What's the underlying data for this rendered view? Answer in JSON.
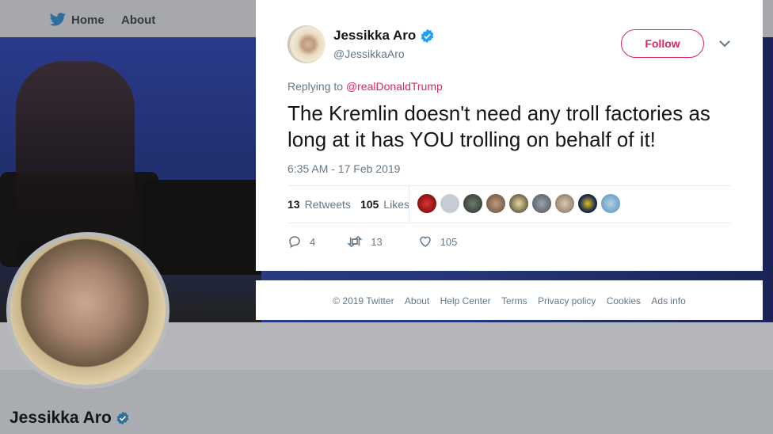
{
  "nav": {
    "home_label": "Home",
    "about_label": "About"
  },
  "profile": {
    "name": "Jessikka Aro"
  },
  "tweet": {
    "author_name": "Jessikka Aro",
    "author_handle": "@JessikkaAro",
    "follow_label": "Follow",
    "replying_prefix": "Replying to",
    "replying_to": "@realDonaldTrump",
    "text": "The Kremlin doesn't need any troll factories as long at it has YOU trolling on behalf of it!",
    "timestamp": "6:35 AM - 17 Feb 2019",
    "retweets_count": "13",
    "retweets_label": "Retweets",
    "likes_count": "105",
    "likes_label": "Likes",
    "reply_count": "4",
    "retweet_count": "13",
    "like_count": "105"
  },
  "footer": {
    "links": [
      "© 2019 Twitter",
      "About",
      "Help Center",
      "Terms",
      "Privacy policy",
      "Cookies",
      "Ads info"
    ]
  },
  "colors": {
    "accent": "#e0245e",
    "verified": "#1da1f2",
    "secondary_text": "#657786"
  }
}
